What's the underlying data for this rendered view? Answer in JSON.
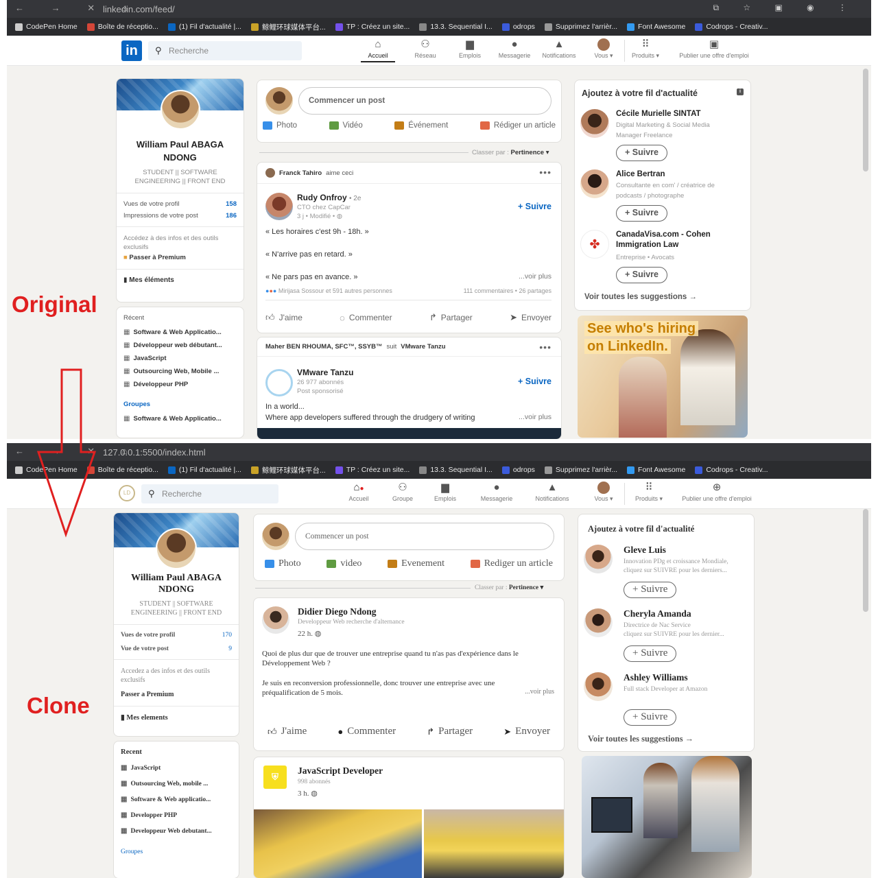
{
  "browser": {
    "top_url": "linkedin.com/feed/",
    "bottom_url": "127.0.0.1:5500/index.html",
    "bookmarks": [
      {
        "label": "CodePen Home",
        "color": "#cccccc"
      },
      {
        "label": "Boîte de réceptio...",
        "color": "#d44638"
      },
      {
        "label": "(1) Fil d'actualité |...",
        "color": "#0a66c2"
      },
      {
        "label": "鲸鲤环球媒体平台...",
        "color": "#c9a227"
      },
      {
        "label": "TP : Créez un site...",
        "color": "#7451eb"
      },
      {
        "label": "13.3. Sequential I...",
        "color": "#888888"
      },
      {
        "label": "odrops",
        "color": "#3b5bdb"
      },
      {
        "label": "Supprimez l'arrièr...",
        "color": "#999999"
      },
      {
        "label": "Font Awesome",
        "color": "#339af0"
      },
      {
        "label": "Codrops - Creativ...",
        "color": "#3b5bdb"
      }
    ]
  },
  "labels": {
    "original": "Original",
    "clone": "Clone"
  },
  "original": {
    "nav": {
      "search_placeholder": "Recherche",
      "items": [
        "Accueil",
        "Réseau",
        "Emplois",
        "Messagerie",
        "Notifications",
        "Vous",
        "Produits",
        "Publier une offre d'emploi"
      ]
    },
    "profile": {
      "name": "William Paul ABAGA NDONG",
      "subtitle": "STUDENT || SOFTWARE ENGINEERING || FRONT END",
      "stat1_label": "Vues de votre profil",
      "stat1_value": "158",
      "stat2_label": "Impressions de votre post",
      "stat2_value": "186",
      "premium_text": "Accédez à des infos et des outils exclusifs",
      "premium_link": "Passer à Premium",
      "items_label": "Mes éléments"
    },
    "recent": {
      "title": "Récent",
      "items": [
        "Software & Web Applicatio...",
        "Développeur web débutant...",
        "JavaScript",
        "Outsourcing Web, Mobile ...",
        "Développeur PHP"
      ],
      "groups": "Groupes",
      "group_item": "Software & Web Applicatio..."
    },
    "composer": {
      "placeholder": "Commencer un post",
      "actions": [
        "Photo",
        "Vidéo",
        "Événement",
        "Rédiger un article"
      ]
    },
    "sort": {
      "label": "Classer par :",
      "value": "Pertinence"
    },
    "post1": {
      "header_name": "Franck Tahiro",
      "header_action": "aime ceci",
      "author": "Rudy Onfroy",
      "degree": "• 2e",
      "sub1": "CTO chez CapCar",
      "sub2": "3 j • Modifié •",
      "follow": "+ Suivre",
      "line1": "« Les horaires c'est 9h - 18h. »",
      "line2": "« N'arrive pas en retard. »",
      "line3": "« Ne pars pas en avance. »",
      "voir_plus": "...voir plus",
      "reactions": "Mirijasa Sossour et 591 autres personnes",
      "comments": "111 commentaires • 26 partages",
      "actions": [
        "J'aime",
        "Commenter",
        "Partager",
        "Envoyer"
      ]
    },
    "post2": {
      "header": "Maher BEN RHOUMA, SFC™, SSYB™",
      "header_action": "suit",
      "header_target": "VMware Tanzu",
      "author": "VMware Tanzu",
      "sub1": "26 977 abonnés",
      "sub2": "Post sponsorisé",
      "follow": "+ Suivre",
      "line1": "In a world...",
      "line2": "Where app developers suffered through the drudgery of writing",
      "voir_plus": "...voir plus"
    },
    "rail": {
      "title": "Ajoutez à votre fil d'actualité",
      "suggestions": [
        {
          "name": "Cécile Murielle SINTAT",
          "desc1": "Digital Marketing & Social Media",
          "desc2": "Manager Freelance",
          "button": "+ Suivre"
        },
        {
          "name": "Alice Bertran",
          "desc1": "Consultante en com' / créatrice de",
          "desc2": "podcasts / photographe",
          "button": "+ Suivre"
        },
        {
          "name": "CanadaVisa.com - Cohen Immigration Law",
          "desc1": "Entreprise • Avocats",
          "desc2": "",
          "button": "+ Suivre"
        }
      ],
      "see_all": "Voir toutes les suggestions →",
      "ad_line1": "See who's hiring",
      "ad_line2": "on LinkedIn."
    }
  },
  "clone": {
    "nav": {
      "search_placeholder": "Recherche",
      "items": [
        "Accueil",
        "Groupe",
        "Emplois",
        "Messagerie",
        "Notifications",
        "Vous",
        "Produits",
        "Publier une offre d'emploi"
      ]
    },
    "profile": {
      "name": "William Paul ABAGA NDONG",
      "subtitle": "STUDENT || SOFTWARE ENGINEERING || FRONT END",
      "stat1_label": "Vues de votre profil",
      "stat1_value": "170",
      "stat2_label": "Vue de votre post",
      "stat2_value": "9",
      "premium_text": "Accedez a des infos et des outils exclusifs",
      "premium_link": "Passer a Premium",
      "items_label": "Mes elements"
    },
    "recent": {
      "title": "Recent",
      "items": [
        "JavaScript",
        "Outsourcing Web, mobile ...",
        "Software & Web applicatio...",
        "Developper PHP",
        "Developpeur Web debutant..."
      ],
      "groups": "Groupes"
    },
    "composer": {
      "placeholder": "Commencer un post",
      "actions": [
        "Photo",
        "video",
        "Evenement",
        "Rediger un article"
      ]
    },
    "sort": {
      "label": "Classer par :",
      "value": "Pertinence"
    },
    "post1": {
      "author": "Didier Diego Ndong",
      "sub1": "Developpeur Web recherche d'alternance",
      "sub2": "22 h.",
      "line1": "Quoi de plus dur que de trouver une entreprise quand tu n'as pas d'expérience dans le Développement Web ?",
      "line2": "Je suis en reconversion professionnelle, donc trouver une entreprise avec une préqualification de 5 mois.",
      "voir_plus": "...voir plus",
      "actions": [
        "J'aime",
        "Commenter",
        "Partager",
        "Envoyer"
      ]
    },
    "post2": {
      "author": "JavaScript Developer",
      "sub1": "998 abonnés",
      "sub2": "3 h."
    },
    "rail": {
      "title": "Ajoutez à votre fil d'actualité",
      "suggestions": [
        {
          "name": "Gleve Luis",
          "desc1": "Innovation PDg et croissance Mondiale,",
          "desc2": "cliquez sur SUIVRE pour les derniers...",
          "button": "+ Suivre"
        },
        {
          "name": "Cheryla Amanda",
          "desc1": "Directrice de Nac Service",
          "desc2": "cliquez sur SUIVRE pour les dernier...",
          "button": "+ Suivre"
        },
        {
          "name": "Ashley Williams",
          "desc1": "Full stack Developer at Amazon",
          "desc2": "",
          "button": "+ Suivre"
        }
      ],
      "see_all": "Voir toutes les suggestions →"
    }
  }
}
